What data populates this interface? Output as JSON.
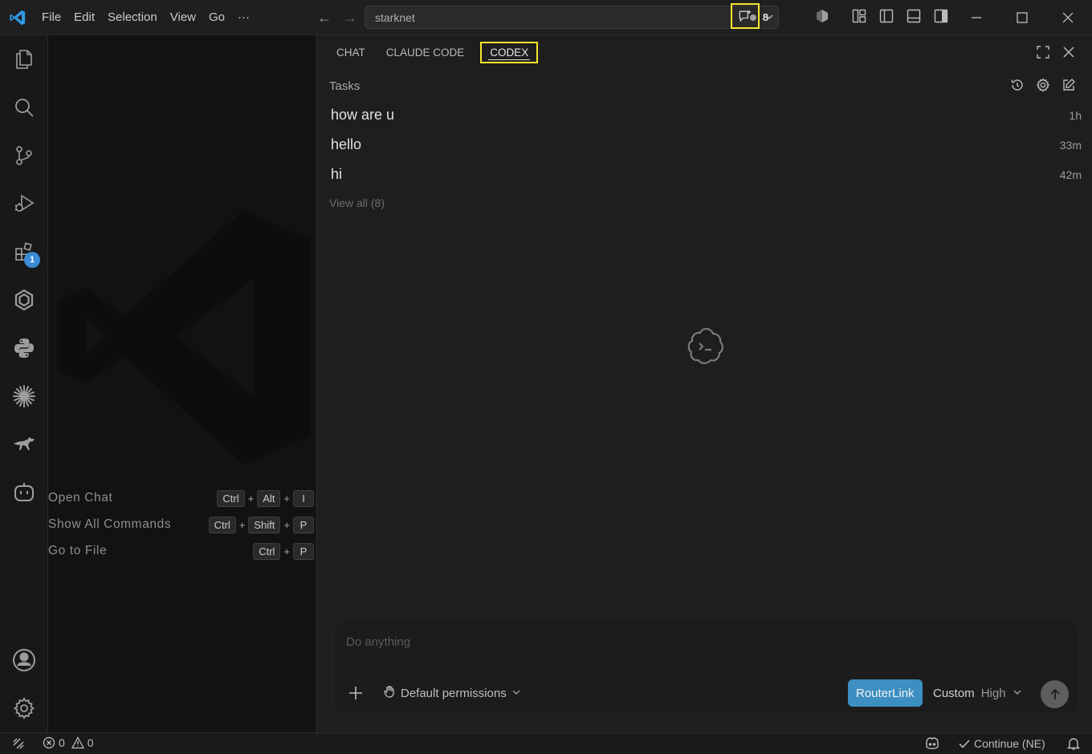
{
  "titlebar": {
    "menu": [
      "File",
      "Edit",
      "Selection",
      "View",
      "Go",
      "···"
    ],
    "search_text": "starknet",
    "notification_count": "8"
  },
  "activitybar": {
    "items": [
      "explorer-icon",
      "search-icon",
      "source-control-icon",
      "run-debug-icon",
      "extensions-icon",
      "hexagon-extension-icon",
      "python-icon",
      "sparkle-icon",
      "kangaroo-icon",
      "copilot-bot-icon"
    ],
    "extensions_badge": "1",
    "bottom": [
      "account-icon",
      "settings-icon"
    ]
  },
  "editor": {
    "shortcuts": [
      {
        "label": "Open Chat",
        "keys": [
          "Ctrl",
          "Alt",
          "I"
        ]
      },
      {
        "label": "Show All Commands",
        "keys": [
          "Ctrl",
          "Shift",
          "P"
        ]
      },
      {
        "label": "Go to File",
        "keys": [
          "Ctrl",
          "P"
        ]
      }
    ]
  },
  "panel": {
    "tabs": [
      "CHAT",
      "CLAUDE CODE",
      "CODEX"
    ],
    "active_tab": "CODEX",
    "tasks_header": "Tasks",
    "tasks": [
      {
        "title": "how are u",
        "time": "1h"
      },
      {
        "title": "hello",
        "time": "33m"
      },
      {
        "title": "hi",
        "time": "42m"
      }
    ],
    "view_all": "View all (8)",
    "composer": {
      "placeholder": "Do anything",
      "permissions": "Default permissions",
      "router": "RouterLink",
      "model": "Custom",
      "effort": "High"
    }
  },
  "statusbar": {
    "errors": "0",
    "warnings": "0",
    "continue": "Continue (NE)"
  },
  "colors": {
    "accent_highlight": "#f5e62e",
    "router_blue": "#3d8fc1",
    "badge_blue": "#3a8ad6"
  }
}
